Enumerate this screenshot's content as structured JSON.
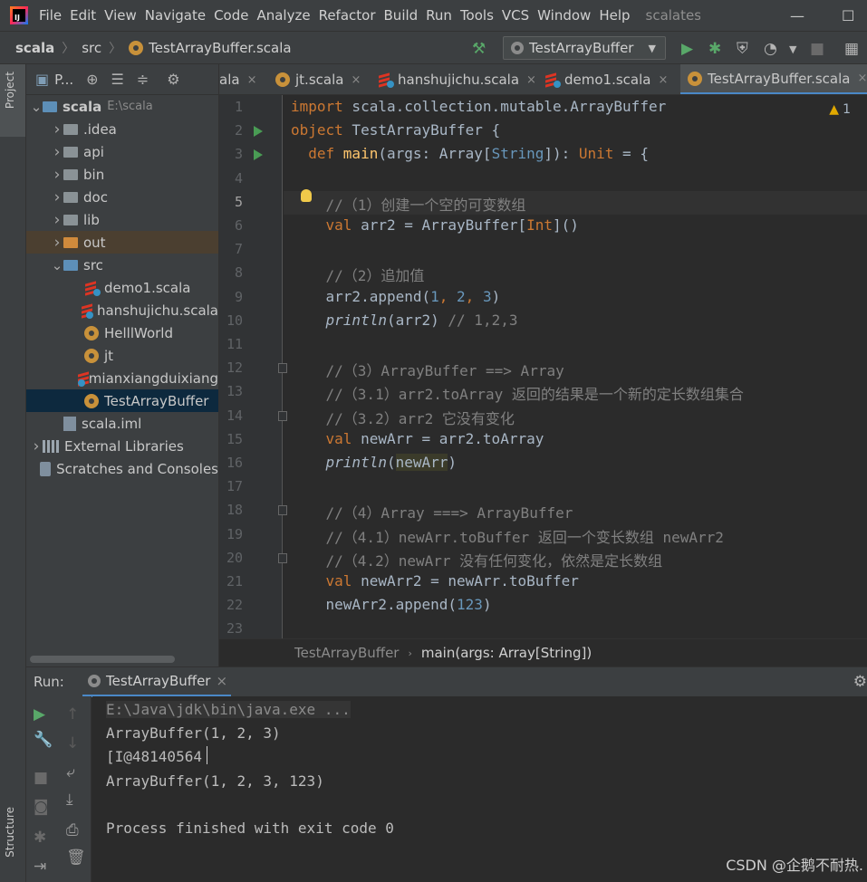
{
  "menubar": {
    "items": [
      "File",
      "Edit",
      "View",
      "Navigate",
      "Code",
      "Analyze",
      "Refactor",
      "Build",
      "Run",
      "Tools",
      "VCS",
      "Window",
      "Help"
    ],
    "project_title": "scalates"
  },
  "navbar": {
    "crumbs": [
      "scala",
      "src",
      "TestArrayBuffer.scala"
    ],
    "run_config": "TestArrayBuffer"
  },
  "left_strip": {
    "project_tab": "Project",
    "structure_tab": "Structure"
  },
  "project_panel": {
    "header_label": "P...",
    "tree": [
      {
        "label": "scala",
        "path": "E:\\scala",
        "depth": 0,
        "icon": "module-folder-icon",
        "expanded": true
      },
      {
        "label": ".idea",
        "depth": 1,
        "icon": "folder-icon"
      },
      {
        "label": "api",
        "depth": 1,
        "icon": "folder-icon"
      },
      {
        "label": "bin",
        "depth": 1,
        "icon": "folder-icon"
      },
      {
        "label": "doc",
        "depth": 1,
        "icon": "folder-icon"
      },
      {
        "label": "lib",
        "depth": 1,
        "icon": "folder-icon"
      },
      {
        "label": "out",
        "depth": 1,
        "icon": "folder-orange-icon",
        "highlighted": true
      },
      {
        "label": "src",
        "depth": 1,
        "icon": "folder-blue-icon",
        "expanded": true
      },
      {
        "label": "demo1.scala",
        "depth": 2,
        "icon": "scala-file-icon"
      },
      {
        "label": "hanshujichu.scala",
        "depth": 2,
        "icon": "scala-file-icon"
      },
      {
        "label": "HelllWorld",
        "depth": 2,
        "icon": "scala-object-icon"
      },
      {
        "label": "jt",
        "depth": 2,
        "icon": "scala-object-icon"
      },
      {
        "label": "mianxiangduixiang",
        "depth": 2,
        "icon": "scala-file-icon"
      },
      {
        "label": "TestArrayBuffer",
        "depth": 2,
        "icon": "scala-object-icon",
        "selected": true
      },
      {
        "label": "scala.iml",
        "depth": 1,
        "icon": "iml-file-icon"
      },
      {
        "label": "External Libraries",
        "depth": 0,
        "icon": "library-icon"
      },
      {
        "label": "Scratches and Consoles",
        "depth": 0,
        "icon": "scratches-icon"
      }
    ]
  },
  "editor_tabs": [
    {
      "label": "ala",
      "icon": "scala-file-icon"
    },
    {
      "label": "jt.scala",
      "icon": "scala-object-icon"
    },
    {
      "label": "hanshujichu.scala",
      "icon": "scala-file-icon"
    },
    {
      "label": "demo1.scala",
      "icon": "scala-file-icon"
    },
    {
      "label": "TestArrayBuffer.scala",
      "icon": "scala-object-icon",
      "active": true
    }
  ],
  "editor": {
    "warning_count": "1",
    "current_line": 5,
    "run_gutter_lines": [
      2,
      3
    ],
    "fold_lines": [
      12,
      14,
      18,
      20
    ],
    "lines": [
      {
        "n": "1",
        "tokens": [
          {
            "t": "import",
            "c": "kw"
          },
          {
            "t": " scala.collection.mutable.ArrayBuffer",
            "c": ""
          }
        ]
      },
      {
        "n": "2",
        "tokens": [
          {
            "t": "object",
            "c": "kw"
          },
          {
            "t": " TestArrayBuffer {",
            "c": ""
          }
        ]
      },
      {
        "n": "3",
        "tokens": [
          {
            "t": "  def ",
            "c": "kw"
          },
          {
            "t": "main",
            "c": "fn"
          },
          {
            "t": "(args: Array[",
            "c": ""
          },
          {
            "t": "String",
            "c": "ty"
          },
          {
            "t": "]): ",
            "c": ""
          },
          {
            "t": "Unit",
            "c": "kw"
          },
          {
            "t": " = {",
            "c": ""
          }
        ]
      },
      {
        "n": "4",
        "tokens": []
      },
      {
        "n": "5",
        "tokens": [
          {
            "t": "    //（1）创建一个空的可变数组",
            "c": "cm"
          }
        ]
      },
      {
        "n": "6",
        "tokens": [
          {
            "t": "    val ",
            "c": "kw"
          },
          {
            "t": "arr2 = ArrayBuffer[",
            "c": ""
          },
          {
            "t": "Int",
            "c": "kw"
          },
          {
            "t": "]()",
            "c": ""
          }
        ]
      },
      {
        "n": "7",
        "tokens": []
      },
      {
        "n": "8",
        "tokens": [
          {
            "t": "    //（2）追加值",
            "c": "cm"
          }
        ]
      },
      {
        "n": "9",
        "tokens": [
          {
            "t": "    arr2.append(",
            "c": ""
          },
          {
            "t": "1",
            "c": "num"
          },
          {
            "t": ", ",
            "c": "kw"
          },
          {
            "t": "2",
            "c": "num"
          },
          {
            "t": ", ",
            "c": "kw"
          },
          {
            "t": "3",
            "c": "num"
          },
          {
            "t": ")",
            "c": ""
          }
        ]
      },
      {
        "n": "10",
        "tokens": [
          {
            "t": "    ",
            "c": ""
          },
          {
            "t": "println",
            "c": "it"
          },
          {
            "t": "(arr2) ",
            "c": ""
          },
          {
            "t": "// 1,2,3",
            "c": "cm"
          }
        ]
      },
      {
        "n": "11",
        "tokens": []
      },
      {
        "n": "12",
        "tokens": [
          {
            "t": "    //（3）ArrayBuffer ==> Array",
            "c": "cm"
          }
        ]
      },
      {
        "n": "13",
        "tokens": [
          {
            "t": "    //（3.1）arr2.toArray 返回的结果是一个新的定长数组集合",
            "c": "cm"
          }
        ]
      },
      {
        "n": "14",
        "tokens": [
          {
            "t": "    //（3.2）arr2 它没有变化",
            "c": "cm"
          }
        ]
      },
      {
        "n": "15",
        "tokens": [
          {
            "t": "    val ",
            "c": "kw"
          },
          {
            "t": "newArr = arr2.toArray",
            "c": ""
          }
        ]
      },
      {
        "n": "16",
        "tokens": [
          {
            "t": "    ",
            "c": ""
          },
          {
            "t": "println",
            "c": "it"
          },
          {
            "t": "(",
            "c": ""
          },
          {
            "t": "newArr",
            "c": "ref"
          },
          {
            "t": ")",
            "c": ""
          }
        ]
      },
      {
        "n": "17",
        "tokens": []
      },
      {
        "n": "18",
        "tokens": [
          {
            "t": "    //（4）Array ===> ArrayBuffer",
            "c": "cm"
          }
        ]
      },
      {
        "n": "19",
        "tokens": [
          {
            "t": "    //（4.1）newArr.toBuffer 返回一个变长数组 newArr2",
            "c": "cm"
          }
        ]
      },
      {
        "n": "20",
        "tokens": [
          {
            "t": "    //（4.2）newArr 没有任何变化，依然是定长数组",
            "c": "cm"
          }
        ]
      },
      {
        "n": "21",
        "tokens": [
          {
            "t": "    val ",
            "c": "kw"
          },
          {
            "t": "newArr2 = newArr.toBuffer",
            "c": ""
          }
        ]
      },
      {
        "n": "22",
        "tokens": [
          {
            "t": "    newArr2.append(",
            "c": ""
          },
          {
            "t": "123",
            "c": "num"
          },
          {
            "t": ")",
            "c": ""
          }
        ]
      },
      {
        "n": "23",
        "tokens": []
      }
    ]
  },
  "editor_breadcrumbs": [
    "TestArrayBuffer",
    "main(args: Array[String])"
  ],
  "run_panel": {
    "label": "Run:",
    "tab": "TestArrayBuffer",
    "console": [
      {
        "text": "E:\\Java\\jdk\\bin\\java.exe ...",
        "kind": "cmd"
      },
      {
        "text": "ArrayBuffer(1, 2, 3)",
        "kind": "out"
      },
      {
        "text": "[I@48140564",
        "kind": "out"
      },
      {
        "text": "ArrayBuffer(1, 2, 3, 123)",
        "kind": "out"
      },
      {
        "text": "",
        "kind": "out"
      },
      {
        "text": "Process finished with exit code 0",
        "kind": "out"
      }
    ]
  },
  "watermark": "CSDN @企鹅不耐热."
}
